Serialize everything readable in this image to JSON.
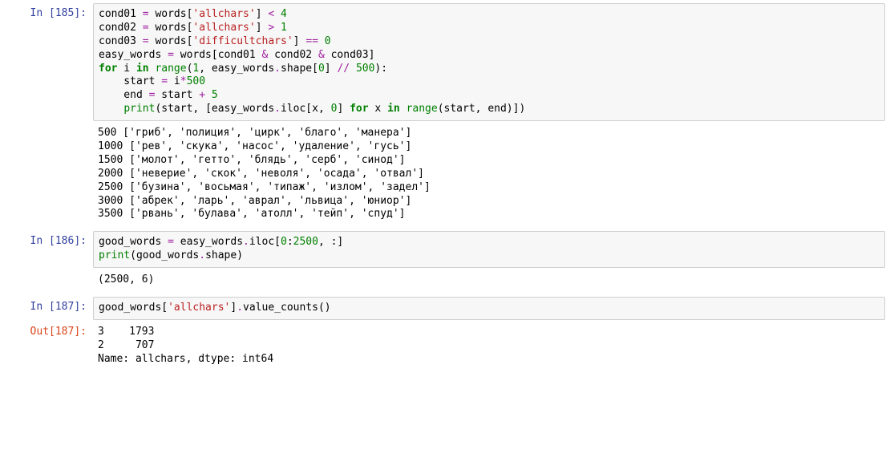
{
  "cells": [
    {
      "prompt_in": "In [185]:",
      "code_tokens": [
        [
          [
            "d",
            "cond01 "
          ],
          [
            "o",
            "="
          ],
          [
            "d",
            " words["
          ],
          [
            "s",
            "'allchars'"
          ],
          [
            "d",
            "] "
          ],
          [
            "o",
            "<"
          ],
          [
            "d",
            " "
          ],
          [
            "n",
            "4"
          ]
        ],
        [
          [
            "d",
            "cond02 "
          ],
          [
            "o",
            "="
          ],
          [
            "d",
            " words["
          ],
          [
            "s",
            "'allchars'"
          ],
          [
            "d",
            "] "
          ],
          [
            "o",
            ">"
          ],
          [
            "d",
            " "
          ],
          [
            "n",
            "1"
          ]
        ],
        [
          [
            "d",
            "cond03 "
          ],
          [
            "o",
            "="
          ],
          [
            "d",
            " words["
          ],
          [
            "s",
            "'difficultchars'"
          ],
          [
            "d",
            "] "
          ],
          [
            "o",
            "=="
          ],
          [
            "d",
            " "
          ],
          [
            "n",
            "0"
          ]
        ],
        [
          [
            "d",
            "easy_words "
          ],
          [
            "o",
            "="
          ],
          [
            "d",
            " words[cond01 "
          ],
          [
            "o",
            "&"
          ],
          [
            "d",
            " cond02 "
          ],
          [
            "o",
            "&"
          ],
          [
            "d",
            " cond03]"
          ]
        ],
        [
          [
            "k",
            "for"
          ],
          [
            "d",
            " i "
          ],
          [
            "k",
            "in"
          ],
          [
            "d",
            " "
          ],
          [
            "bi",
            "range"
          ],
          [
            "d",
            "("
          ],
          [
            "n",
            "1"
          ],
          [
            "d",
            ", easy_words"
          ],
          [
            "o",
            "."
          ],
          [
            "d",
            "shape["
          ],
          [
            "n",
            "0"
          ],
          [
            "d",
            "] "
          ],
          [
            "o",
            "//"
          ],
          [
            "d",
            " "
          ],
          [
            "n",
            "500"
          ],
          [
            "d",
            "):"
          ]
        ],
        [
          [
            "d",
            "    start "
          ],
          [
            "o",
            "="
          ],
          [
            "d",
            " i"
          ],
          [
            "o",
            "*"
          ],
          [
            "n",
            "500"
          ]
        ],
        [
          [
            "d",
            "    end "
          ],
          [
            "o",
            "="
          ],
          [
            "d",
            " start "
          ],
          [
            "o",
            "+"
          ],
          [
            "d",
            " "
          ],
          [
            "n",
            "5"
          ]
        ],
        [
          [
            "d",
            "    "
          ],
          [
            "bi",
            "print"
          ],
          [
            "d",
            "(start, [easy_words"
          ],
          [
            "o",
            "."
          ],
          [
            "d",
            "iloc[x, "
          ],
          [
            "n",
            "0"
          ],
          [
            "d",
            "] "
          ],
          [
            "k",
            "for"
          ],
          [
            "d",
            " x "
          ],
          [
            "k",
            "in"
          ],
          [
            "d",
            " "
          ],
          [
            "bi",
            "range"
          ],
          [
            "d",
            "(start, end)])"
          ]
        ]
      ],
      "output_lines": [
        "500 ['гриб', 'полиция', 'цирк', 'благо', 'манера']",
        "1000 ['рев', 'скука', 'насос', 'удаление', 'гусь']",
        "1500 ['молот', 'гетто', 'блядь', 'серб', 'синод']",
        "2000 ['неверие', 'скок', 'неволя', 'осада', 'отвал']",
        "2500 ['бузина', 'восьмая', 'типаж', 'излом', 'задел']",
        "3000 ['абрек', 'ларь', 'аврал', 'львица', 'юниор']",
        "3500 ['рвань', 'булава', 'атолл', 'тейп', 'спуд']"
      ]
    },
    {
      "prompt_in": "In [186]:",
      "code_tokens": [
        [
          [
            "d",
            "good_words "
          ],
          [
            "o",
            "="
          ],
          [
            "d",
            " easy_words"
          ],
          [
            "o",
            "."
          ],
          [
            "d",
            "iloc["
          ],
          [
            "n",
            "0"
          ],
          [
            "d",
            ":"
          ],
          [
            "n",
            "2500"
          ],
          [
            "d",
            ", :]"
          ]
        ],
        [
          [
            "bi",
            "print"
          ],
          [
            "d",
            "(good_words"
          ],
          [
            "o",
            "."
          ],
          [
            "d",
            "shape)"
          ]
        ]
      ],
      "output_lines": [
        "(2500, 6)"
      ]
    },
    {
      "prompt_in": "In [187]:",
      "prompt_out": "Out[187]:",
      "code_tokens": [
        [
          [
            "d",
            "good_words["
          ],
          [
            "s",
            "'allchars'"
          ],
          [
            "d",
            "]"
          ],
          [
            "o",
            "."
          ],
          [
            "d",
            "value_counts()"
          ]
        ]
      ],
      "output_lines": [
        "3    1793",
        "2     707",
        "Name: allchars, dtype: int64"
      ]
    }
  ]
}
